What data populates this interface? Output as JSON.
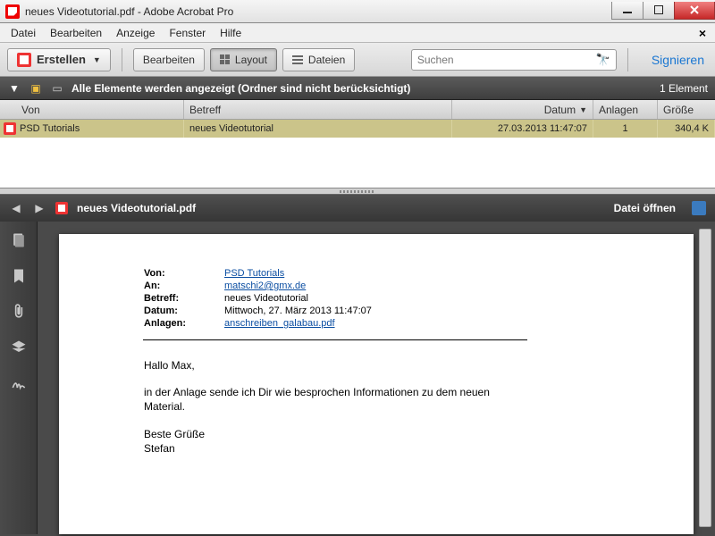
{
  "titlebar": {
    "title": "neues Videotutorial.pdf - Adobe Acrobat Pro"
  },
  "menu": {
    "items": [
      "Datei",
      "Bearbeiten",
      "Anzeige",
      "Fenster",
      "Hilfe"
    ]
  },
  "toolbar": {
    "create": "Erstellen",
    "edit": "Bearbeiten",
    "layout": "Layout",
    "files": "Dateien",
    "search_placeholder": "Suchen",
    "sign": "Signieren"
  },
  "filterbar": {
    "text": "Alle Elemente werden angezeigt (Ordner sind nicht berücksichtigt)",
    "count": "1 Element"
  },
  "columns": {
    "von": "Von",
    "betreff": "Betreff",
    "datum": "Datum",
    "anlagen": "Anlagen",
    "groesse": "Größe"
  },
  "rows": [
    {
      "von": "PSD Tutorials",
      "betreff": "neues Videotutorial",
      "datum": "27.03.2013 11:47:07",
      "anlagen": "1",
      "groesse": "340,4 K"
    }
  ],
  "preview": {
    "filename": "neues Videotutorial.pdf",
    "open_label": "Datei öffnen"
  },
  "email": {
    "labels": {
      "von": "Von:",
      "an": "An:",
      "betreff": "Betreff:",
      "datum": "Datum:",
      "anlagen": "Anlagen:"
    },
    "von": "PSD Tutorials",
    "an": "matschi2@gmx.de",
    "betreff": "neues Videotutorial",
    "datum": "Mittwoch, 27. März 2013 11:47:07",
    "anlagen": "anschreiben_galabau.pdf",
    "body_greeting": "Hallo Max,",
    "body_text": "in der Anlage sende ich Dir wie besprochen Informationen zu dem neuen Material.",
    "body_closing": "Beste Grüße",
    "body_sign": "Stefan"
  }
}
